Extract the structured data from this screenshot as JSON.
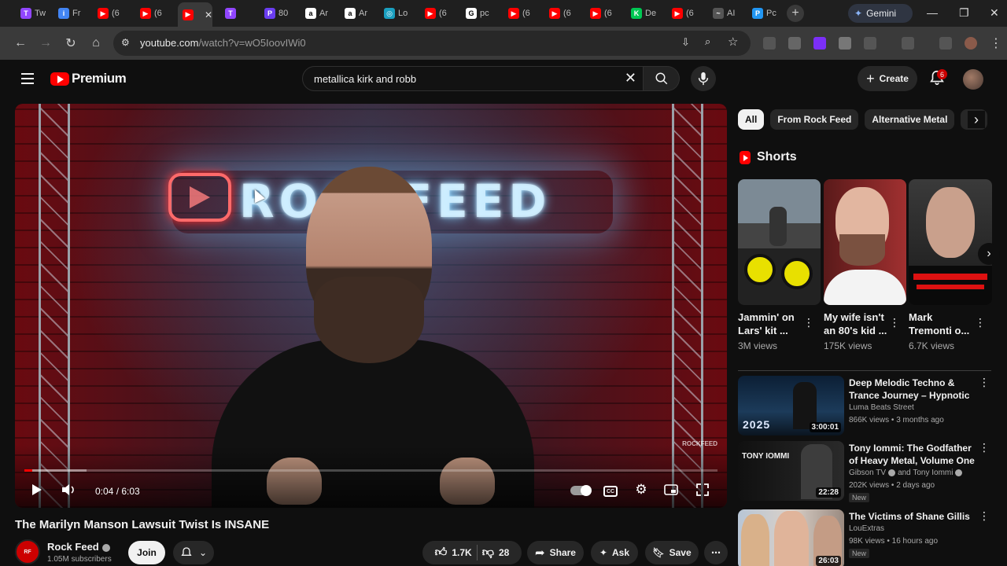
{
  "browser": {
    "tabs": [
      {
        "title": "Tw",
        "color": "#9146ff",
        "glyph": "T"
      },
      {
        "title": "Fr",
        "color": "#4285f4",
        "glyph": "i"
      },
      {
        "title": "(6",
        "color": "#ff0000",
        "glyph": "▶"
      },
      {
        "title": "(6",
        "color": "#ff0000",
        "glyph": "▶"
      },
      {
        "title": "",
        "color": "#ff0000",
        "glyph": "▶",
        "active": true
      },
      {
        "title": "",
        "color": "#9146ff",
        "glyph": "T"
      },
      {
        "title": "80",
        "color": "#6a3df0",
        "glyph": "P"
      },
      {
        "title": "Ar",
        "color": "#ffffff",
        "glyph": "a"
      },
      {
        "title": "Ar",
        "color": "#ffffff",
        "glyph": "a"
      },
      {
        "title": "Lo",
        "color": "#1a9fbf",
        "glyph": "◎"
      },
      {
        "title": "(6",
        "color": "#ff0000",
        "glyph": "▶"
      },
      {
        "title": "pc",
        "color": "#ffffff",
        "glyph": "G"
      },
      {
        "title": "(6",
        "color": "#ff0000",
        "glyph": "▶"
      },
      {
        "title": "(6",
        "color": "#ff0000",
        "glyph": "▶"
      },
      {
        "title": "(6",
        "color": "#ff0000",
        "glyph": "▶"
      },
      {
        "title": "De",
        "color": "#00c853",
        "glyph": "K"
      },
      {
        "title": "(6",
        "color": "#ff0000",
        "glyph": "▶"
      },
      {
        "title": "AI",
        "color": "#555555",
        "glyph": "~"
      },
      {
        "title": "Pc",
        "color": "#2196f3",
        "glyph": "P"
      }
    ],
    "gemini_label": "Gemini",
    "url_domain": "youtube.com",
    "url_path": "/watch?v=wO5IoovIWi0"
  },
  "header": {
    "logo_text": "Premium",
    "search_query": "metallica kirk and robb",
    "create_label": "Create",
    "notification_count": "6"
  },
  "player": {
    "neon_text": "ROCKFEED",
    "watermark": "ROCKFEED",
    "time": "0:04 / 6:03",
    "progress_played": 0.011,
    "progress_loaded": 0.09
  },
  "video": {
    "title": "The Marilyn Manson Lawsuit Twist Is INSANE",
    "channel": "Rock Feed",
    "subscribers": "1.05M subscribers",
    "join_label": "Join",
    "likes": "1.7K",
    "dislikes": "28",
    "share_label": "Share",
    "ask_label": "Ask",
    "save_label": "Save"
  },
  "sidebar": {
    "chips": [
      "All",
      "From Rock Feed",
      "Alternative Metal",
      "Ro"
    ],
    "shorts_label": "Shorts",
    "shorts": [
      {
        "title": "Jammin' on Lars' kit ...",
        "views": "3M views"
      },
      {
        "title": "My wife isn't an 80's kid ...",
        "views": "175K views"
      },
      {
        "title": "Mark Tremonti o...",
        "views": "6.7K views"
      }
    ],
    "recommendations": [
      {
        "title": "Deep Melodic Techno & Trance Journey – Hypnotic Mix for ...",
        "channel": "Luma Beats Street",
        "meta": "866K views • 3 months ago",
        "duration": "3:00:01",
        "thumb_text": "2025"
      },
      {
        "title": "Tony Iommi: The Godfather of Heavy Metal, Volume One",
        "channel": "Gibson TV",
        "channel2": "and Tony Iommi",
        "meta": "202K views • 2 days ago",
        "duration": "22:28",
        "badge": "New",
        "thumb_text": "TONY IOMMI"
      },
      {
        "title": "The Victims of Shane Gillis",
        "channel": "LouExtras",
        "meta": "98K views • 16 hours ago",
        "duration": "26:03",
        "badge": "New"
      }
    ]
  }
}
